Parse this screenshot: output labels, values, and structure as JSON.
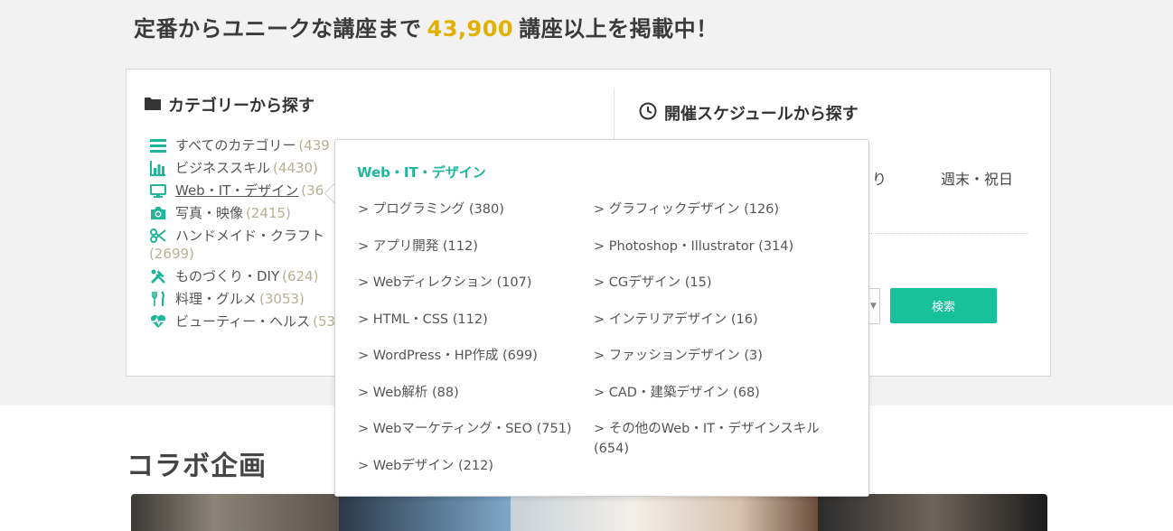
{
  "headline": {
    "prefix": "定番からユニークな講座まで",
    "number": "43,900",
    "suffix": "講座以上を掲載中！"
  },
  "category_section": {
    "title": "カテゴリーから探す",
    "items": [
      {
        "label": "すべてのカテゴリー",
        "count": "(439",
        "icon": "list-icon"
      },
      {
        "label": "ビジネススキル",
        "count": "(4430)",
        "icon": "bar-chart-icon"
      },
      {
        "label": "Web・IT・デザイン",
        "count": "(36",
        "icon": "monitor-icon"
      },
      {
        "label": "写真・映像",
        "count": "(2415)",
        "icon": "camera-icon"
      },
      {
        "label": "ハンドメイド・クラフト",
        "count": "(2699)",
        "icon": "scissors-icon"
      },
      {
        "label": "ものづくり・DIY",
        "count": "(624)",
        "icon": "tools-icon"
      },
      {
        "label": "料理・グルメ",
        "count": "(3053)",
        "icon": "cutlery-icon"
      },
      {
        "label": "ビューティー・ヘルス",
        "count": "(53",
        "icon": "heartbeat-icon"
      }
    ]
  },
  "schedule_section": {
    "title": "開催スケジュールから探す",
    "option_partial": "り",
    "option_weekend": "週末・祝日",
    "select_arrow": "▼",
    "search_button": "検索"
  },
  "popup": {
    "title": "Web・IT・デザイン",
    "left_column": [
      "> プログラミング (380)",
      "> アプリ開発 (112)",
      "> Webディレクション (107)",
      "> HTML・CSS (112)",
      "> WordPress・HP作成 (699)",
      "> Web解析 (88)",
      "> Webマーケティング・SEO (751)",
      "> Webデザイン (212)"
    ],
    "right_column": [
      "> グラフィックデザイン (126)",
      "> Photoshop・Illustrator (314)",
      "> CGデザイン (15)",
      "> インテリアデザイン (16)",
      "> ファッションデザイン (3)",
      "> CAD・建築デザイン (68)",
      "> その他のWeb・IT・デザインスキル (654)"
    ]
  },
  "collab": {
    "title": "コラボ企画"
  },
  "colors": {
    "accent_green": "#20b69b",
    "button_green": "#19c09c",
    "highlight_yellow": "#e2b100",
    "count_gray": "#b6b096"
  }
}
